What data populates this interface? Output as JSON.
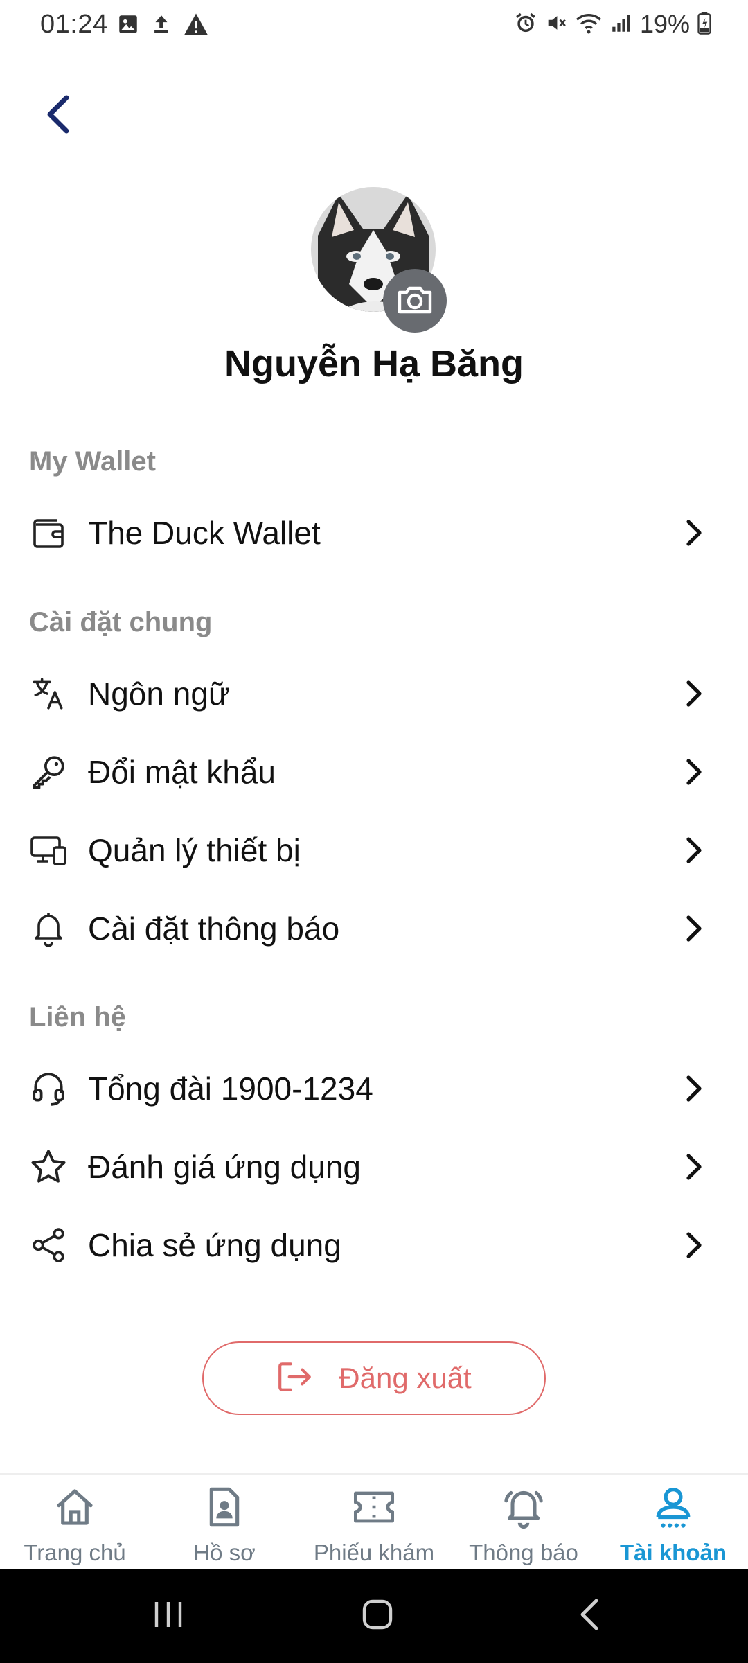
{
  "status_bar": {
    "time": "01:24",
    "battery": "19%",
    "left_icons": [
      "image-icon",
      "upload-icon",
      "warning-icon"
    ],
    "right_icons": [
      "alarm-icon",
      "mute-icon",
      "wifi-icon",
      "signal-icon",
      "battery-icon"
    ]
  },
  "profile": {
    "name": "Nguyễn Hạ Băng"
  },
  "sections": {
    "wallet": {
      "title": "My Wallet",
      "items": [
        {
          "label": "The Duck Wallet",
          "icon": "wallet-icon"
        }
      ]
    },
    "general": {
      "title": "Cài đặt chung",
      "items": [
        {
          "label": "Ngôn ngữ",
          "icon": "translate-icon"
        },
        {
          "label": "Đổi mật khẩu",
          "icon": "key-icon"
        },
        {
          "label": "Quản lý thiết bị",
          "icon": "devices-icon"
        },
        {
          "label": "Cài đặt thông báo",
          "icon": "bell-icon"
        }
      ]
    },
    "contact": {
      "title": "Liên hệ",
      "items": [
        {
          "label": "Tổng đài 1900-1234",
          "icon": "headset-icon"
        },
        {
          "label": "Đánh giá ứng dụng",
          "icon": "star-icon"
        },
        {
          "label": "Chia sẻ ứng dụng",
          "icon": "share-icon"
        }
      ]
    }
  },
  "logout": {
    "label": "Đăng xuất",
    "color": "#e06a6a"
  },
  "bottom_nav": {
    "active_color": "#1996d4",
    "items": [
      {
        "label": "Trang chủ",
        "icon": "home-icon",
        "active": false
      },
      {
        "label": "Hồ sơ",
        "icon": "profile-document-icon",
        "active": false
      },
      {
        "label": "Phiếu khám",
        "icon": "ticket-icon",
        "active": false
      },
      {
        "label": "Thông báo",
        "icon": "notification-bell-icon",
        "active": false
      },
      {
        "label": "Tài khoản",
        "icon": "account-icon",
        "active": true
      }
    ]
  }
}
